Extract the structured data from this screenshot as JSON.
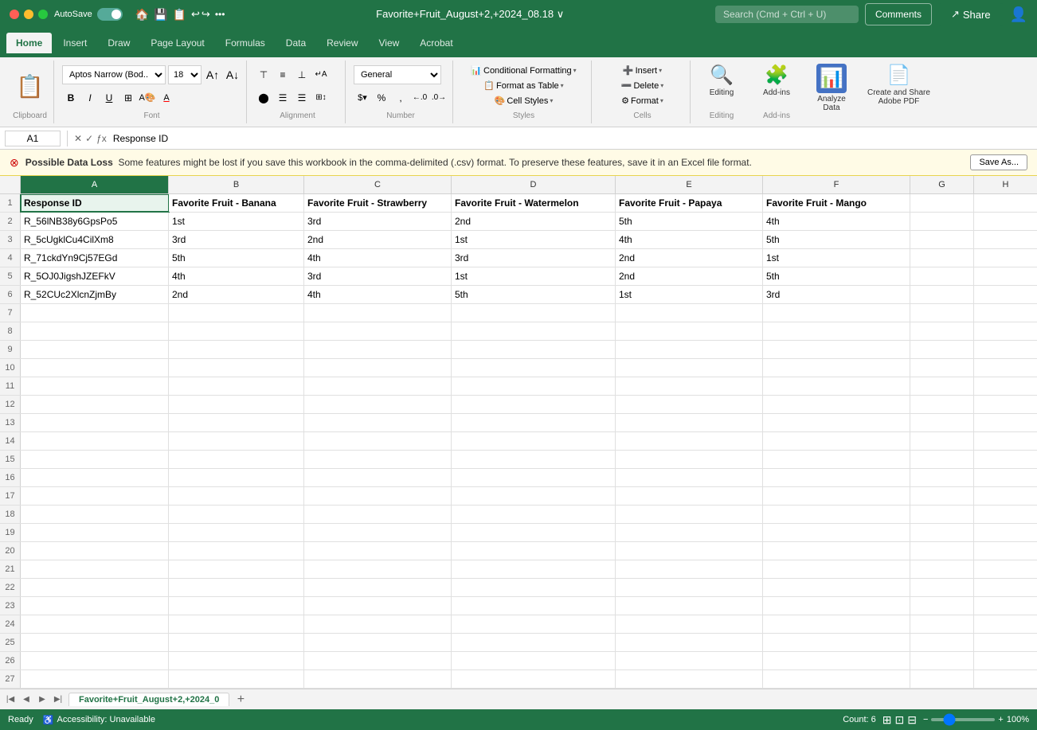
{
  "window": {
    "title": "Favorite+Fruit_August+2,+2024_08.18",
    "autosave_label": "AutoSave"
  },
  "ribbon": {
    "tabs": [
      "Home",
      "Insert",
      "Draw",
      "Page Layout",
      "Formulas",
      "Data",
      "Review",
      "View",
      "Acrobat"
    ],
    "active_tab": "Home"
  },
  "toolbar": {
    "font_family": "Aptos Narrow (Bod...",
    "font_size": "18",
    "format": "General",
    "bold": "B",
    "italic": "I",
    "underline": "U",
    "paste_label": "Paste",
    "clipboard_label": "Clipboard",
    "font_label": "Font",
    "alignment_label": "Alignment",
    "number_label": "Number",
    "styles_label": "Styles",
    "cells_label": "Cells",
    "editing_label": "Editing",
    "conditional_formatting": "Conditional Formatting",
    "format_as_table": "Format as Table",
    "cell_styles": "Cell Styles",
    "insert_label": "Insert",
    "delete_label": "Delete",
    "format_label": "Format"
  },
  "formula_bar": {
    "cell_ref": "A1",
    "formula": "Response ID"
  },
  "notification": {
    "icon": "⚠",
    "text": "Possible Data Loss  Some features might be lost if you save this workbook in the comma-delimited (.csv) format. To preserve these features, save it in an Excel file format.",
    "save_as_label": "Save As..."
  },
  "spreadsheet": {
    "columns": [
      {
        "label": "A",
        "key": "col-a"
      },
      {
        "label": "B",
        "key": "col-b"
      },
      {
        "label": "C",
        "key": "col-c"
      },
      {
        "label": "D",
        "key": "col-d"
      },
      {
        "label": "E",
        "key": "col-e"
      },
      {
        "label": "F",
        "key": "col-f"
      },
      {
        "label": "G",
        "key": "col-g"
      },
      {
        "label": "H",
        "key": "col-h"
      }
    ],
    "rows": [
      {
        "num": "1",
        "cells": [
          "Response ID",
          "Favorite Fruit - Banana",
          "Favorite Fruit - Strawberry",
          "Favorite Fruit - Watermelon",
          "Favorite Fruit - Papaya",
          "Favorite Fruit - Mango",
          "",
          ""
        ]
      },
      {
        "num": "2",
        "cells": [
          "R_56lNB38y6GpsPo5",
          "1st",
          "3rd",
          "2nd",
          "5th",
          "4th",
          "",
          ""
        ]
      },
      {
        "num": "3",
        "cells": [
          "R_5cUgklCu4CilXm8",
          "3rd",
          "2nd",
          "1st",
          "4th",
          "5th",
          "",
          ""
        ]
      },
      {
        "num": "4",
        "cells": [
          "R_71ckdYn9Cj57EGd",
          "5th",
          "4th",
          "3rd",
          "2nd",
          "1st",
          "",
          ""
        ]
      },
      {
        "num": "5",
        "cells": [
          "R_5OJ0JigshJZEFkV",
          "4th",
          "3rd",
          "1st",
          "2nd",
          "5th",
          "",
          ""
        ]
      },
      {
        "num": "6",
        "cells": [
          "R_52CUc2XlcnZjmBy",
          "2nd",
          "4th",
          "5th",
          "1st",
          "3rd",
          "",
          ""
        ]
      },
      {
        "num": "7",
        "cells": [
          "",
          "",
          "",
          "",
          "",
          "",
          "",
          ""
        ]
      },
      {
        "num": "8",
        "cells": [
          "",
          "",
          "",
          "",
          "",
          "",
          "",
          ""
        ]
      },
      {
        "num": "9",
        "cells": [
          "",
          "",
          "",
          "",
          "",
          "",
          "",
          ""
        ]
      },
      {
        "num": "10",
        "cells": [
          "",
          "",
          "",
          "",
          "",
          "",
          "",
          ""
        ]
      },
      {
        "num": "11",
        "cells": [
          "",
          "",
          "",
          "",
          "",
          "",
          "",
          ""
        ]
      },
      {
        "num": "12",
        "cells": [
          "",
          "",
          "",
          "",
          "",
          "",
          "",
          ""
        ]
      },
      {
        "num": "13",
        "cells": [
          "",
          "",
          "",
          "",
          "",
          "",
          "",
          ""
        ]
      },
      {
        "num": "14",
        "cells": [
          "",
          "",
          "",
          "",
          "",
          "",
          "",
          ""
        ]
      },
      {
        "num": "15",
        "cells": [
          "",
          "",
          "",
          "",
          "",
          "",
          "",
          ""
        ]
      },
      {
        "num": "16",
        "cells": [
          "",
          "",
          "",
          "",
          "",
          "",
          "",
          ""
        ]
      },
      {
        "num": "17",
        "cells": [
          "",
          "",
          "",
          "",
          "",
          "",
          "",
          ""
        ]
      },
      {
        "num": "18",
        "cells": [
          "",
          "",
          "",
          "",
          "",
          "",
          "",
          ""
        ]
      },
      {
        "num": "19",
        "cells": [
          "",
          "",
          "",
          "",
          "",
          "",
          "",
          ""
        ]
      },
      {
        "num": "20",
        "cells": [
          "",
          "",
          "",
          "",
          "",
          "",
          "",
          ""
        ]
      },
      {
        "num": "21",
        "cells": [
          "",
          "",
          "",
          "",
          "",
          "",
          "",
          ""
        ]
      },
      {
        "num": "22",
        "cells": [
          "",
          "",
          "",
          "",
          "",
          "",
          "",
          ""
        ]
      },
      {
        "num": "23",
        "cells": [
          "",
          "",
          "",
          "",
          "",
          "",
          "",
          ""
        ]
      },
      {
        "num": "24",
        "cells": [
          "",
          "",
          "",
          "",
          "",
          "",
          "",
          ""
        ]
      },
      {
        "num": "25",
        "cells": [
          "",
          "",
          "",
          "",
          "",
          "",
          "",
          ""
        ]
      },
      {
        "num": "26",
        "cells": [
          "",
          "",
          "",
          "",
          "",
          "",
          "",
          ""
        ]
      },
      {
        "num": "27",
        "cells": [
          "",
          "",
          "",
          "",
          "",
          "",
          "",
          ""
        ]
      }
    ]
  },
  "sheet_tab": {
    "name": "Favorite+Fruit_August+2,+2024_0",
    "add_label": "+"
  },
  "status_bar": {
    "ready": "Ready",
    "accessibility": "Accessibility: Unavailable",
    "count": "Count: 6",
    "zoom": "100%"
  },
  "comments_btn": "Comments",
  "share_btn": "Share"
}
